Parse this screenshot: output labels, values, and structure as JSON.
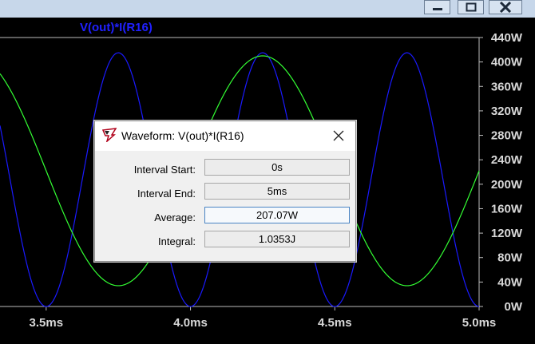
{
  "window": {
    "controls": {
      "minimize": "minimize-icon",
      "maximize": "maximize-icon",
      "close": "close-icon"
    }
  },
  "plot": {
    "trace_label": "V(out)*I(R16)",
    "colors": {
      "background": "#000000",
      "blue_trace": "#1a1aff",
      "green_trace": "#33ff33",
      "text": "#d8d8d8"
    }
  },
  "chart_data": {
    "type": "line",
    "xlim": [
      3.34,
      5.0
    ],
    "ylim": [
      0,
      440
    ],
    "x_ticks": [
      "3.5ms",
      "4.0ms",
      "4.5ms",
      "5.0ms"
    ],
    "y_ticks": [
      "440W",
      "400W",
      "360W",
      "320W",
      "280W",
      "240W",
      "200W",
      "160W",
      "120W",
      "80W",
      "40W",
      "0W"
    ],
    "series": [
      {
        "color": "#1a1aff",
        "kind": "sin2",
        "amplitude": 415,
        "period": 0.5,
        "peak_at": 3.75
      },
      {
        "color": "#33ff33",
        "kind": "cosine",
        "mean": 222,
        "amplitude": 188,
        "period": 1.0,
        "peak_at": 4.25
      }
    ]
  },
  "dialog": {
    "title": "Waveform: V(out)*I(R16)",
    "rows": [
      {
        "label": "Interval Start:",
        "value": "0s"
      },
      {
        "label": "Interval End:",
        "value": "5ms"
      },
      {
        "label": "Average:",
        "value": "207.07W"
      },
      {
        "label": "Integral:",
        "value": "1.0353J"
      }
    ]
  }
}
